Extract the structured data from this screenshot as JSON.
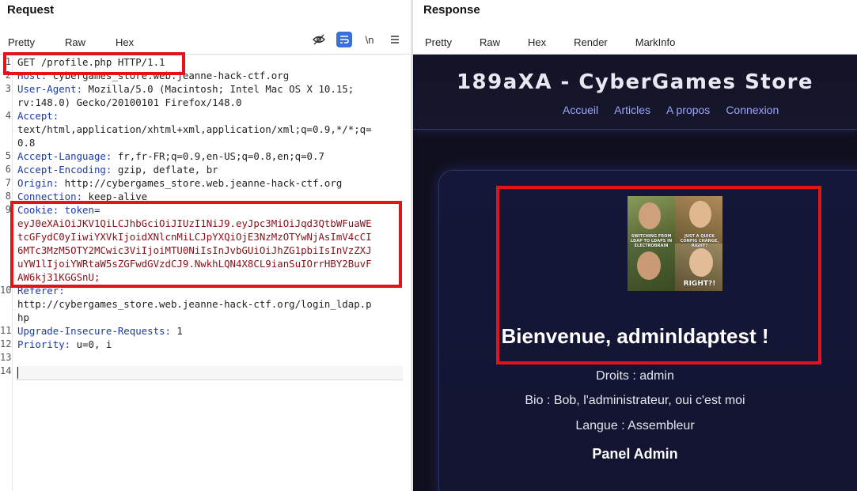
{
  "request": {
    "title": "Request",
    "tabs": [
      "Pretty",
      "Raw",
      "Hex"
    ],
    "tools": [
      "eye-off",
      "wrap",
      "\\n",
      "menu"
    ],
    "lines": [
      {
        "n": "1",
        "parts": [
          {
            "t": "GET /profile.php HTTP/1.1",
            "c": "code"
          }
        ]
      },
      {
        "n": "2",
        "parts": [
          {
            "t": "Host:",
            "c": "hn"
          },
          {
            "t": " cybergames_store.web.jeanne-hack-ctf.org",
            "c": "code"
          }
        ]
      },
      {
        "n": "3",
        "parts": [
          {
            "t": "User-Agent:",
            "c": "hn"
          },
          {
            "t": " Mozilla/5.0 (Macintosh; Intel Mac OS X 10.15;",
            "c": "code"
          }
        ]
      },
      {
        "n": "",
        "parts": [
          {
            "t": "rv:148.0) Gecko/20100101 Firefox/148.0",
            "c": "code"
          }
        ]
      },
      {
        "n": "4",
        "parts": [
          {
            "t": "Accept:",
            "c": "hn"
          }
        ]
      },
      {
        "n": "",
        "parts": [
          {
            "t": "text/html,application/xhtml+xml,application/xml;q=0.9,*/*;q=",
            "c": "code"
          }
        ]
      },
      {
        "n": "",
        "parts": [
          {
            "t": "0.8",
            "c": "code"
          }
        ]
      },
      {
        "n": "5",
        "parts": [
          {
            "t": "Accept-Language:",
            "c": "hn"
          },
          {
            "t": " fr,fr-FR;q=0.9,en-US;q=0.8,en;q=0.7",
            "c": "code"
          }
        ]
      },
      {
        "n": "6",
        "parts": [
          {
            "t": "Accept-Encoding:",
            "c": "hn"
          },
          {
            "t": " gzip, deflate, br",
            "c": "code"
          }
        ]
      },
      {
        "n": "7",
        "parts": [
          {
            "t": "Origin:",
            "c": "hn"
          },
          {
            "t": " http://cybergames_store.web.jeanne-hack-ctf.org",
            "c": "code"
          }
        ]
      },
      {
        "n": "8",
        "parts": [
          {
            "t": "Connection:",
            "c": "hn"
          },
          {
            "t": " keep-alive",
            "c": "code"
          }
        ]
      },
      {
        "n": "9",
        "parts": [
          {
            "t": "Cookie:",
            "c": "hn"
          },
          {
            "t": " token=",
            "c": "cookie-key"
          }
        ]
      },
      {
        "n": "",
        "parts": [
          {
            "t": "eyJ0eXAiOiJKV1QiLCJhbGciOiJIUzI1NiJ9.eyJpc3MiOiJqd3QtbWFuaWE",
            "c": "tok"
          }
        ]
      },
      {
        "n": "",
        "parts": [
          {
            "t": "tcGFydC0yIiwiYXVkIjoidXNlcnMiLCJpYXQiOjE3NzMzOTYwNjAsImV4cCI",
            "c": "tok"
          }
        ]
      },
      {
        "n": "",
        "parts": [
          {
            "t": "6MTc3MzM5OTY2MCwic3ViIjoiMTU0NiIsInJvbGUiOiJhZG1pbiIsInVzZXJ",
            "c": "tok"
          }
        ]
      },
      {
        "n": "",
        "parts": [
          {
            "t": "uYW1lIjoiYWRtaW5sZGFwdGVzdCJ9.NwkhLQN4X8CL9ianSuIOrrHBY2BuvF",
            "c": "tok"
          }
        ]
      },
      {
        "n": "",
        "parts": [
          {
            "t": "AW6kj31KGGSnU;",
            "c": "tok"
          }
        ]
      },
      {
        "n": "10",
        "parts": [
          {
            "t": "Referer:",
            "c": "hn"
          }
        ]
      },
      {
        "n": "",
        "parts": [
          {
            "t": "http://cybergames_store.web.jeanne-hack-ctf.org/login_ldap.p",
            "c": "code"
          }
        ]
      },
      {
        "n": "",
        "parts": [
          {
            "t": "hp",
            "c": "code"
          }
        ]
      },
      {
        "n": "11",
        "parts": [
          {
            "t": "Upgrade-Insecure-Requests:",
            "c": "hn"
          },
          {
            "t": " 1",
            "c": "code"
          }
        ]
      },
      {
        "n": "12",
        "parts": [
          {
            "t": "Priority:",
            "c": "hn"
          },
          {
            "t": " u=0, i",
            "c": "code"
          }
        ]
      },
      {
        "n": "13",
        "parts": []
      },
      {
        "n": "14",
        "parts": []
      }
    ]
  },
  "response": {
    "title": "Response",
    "tabs": [
      "Pretty",
      "Raw",
      "Hex",
      "Render",
      "MarkInfo"
    ],
    "active_tab": "Render",
    "site": {
      "title": "189aXA - CyberGames Store",
      "nav": [
        "Accueil",
        "Articles",
        "A propos",
        "Connexion"
      ],
      "meme_captions": [
        "SWITCHING FROM LDAP TO LDAPS IN ELECTROBRAIN",
        "JUST A QUICK CONFIG CHANGE, RIGHT?",
        "RIGHT?!"
      ],
      "welcome": "Bienvenue, adminldaptest !",
      "droits": "Droits : admin",
      "bio": "Bio : Bob, l'administrateur, oui c'est moi",
      "langue": "Langue : Assembleur",
      "panel": "Panel Admin"
    }
  },
  "colors": {
    "highlight": "#e2141b",
    "accent_tab": "#e4602c",
    "header_name": "#1a3aa8",
    "cookie_value": "#8a0f16"
  }
}
